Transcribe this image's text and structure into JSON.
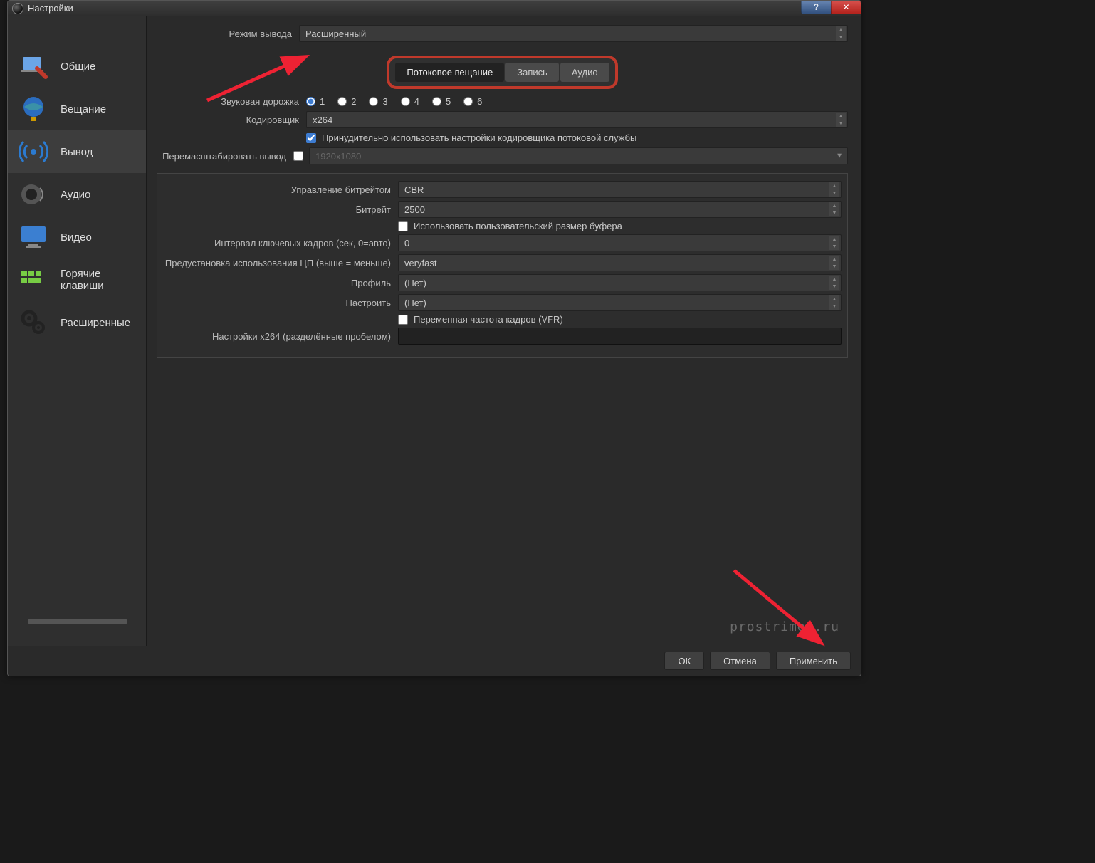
{
  "window": {
    "title": "Настройки"
  },
  "titlebar_buttons": {
    "help": "?",
    "close": "✕"
  },
  "sidebar": {
    "items": [
      {
        "label": "Общие"
      },
      {
        "label": "Вещание"
      },
      {
        "label": "Вывод"
      },
      {
        "label": "Аудио"
      },
      {
        "label": "Видео"
      },
      {
        "label": "Горячие клавиши"
      },
      {
        "label": "Расширенные"
      }
    ]
  },
  "output_mode": {
    "label": "Режим вывода",
    "value": "Расширенный"
  },
  "tabs": {
    "streaming": "Потоковое вещание",
    "recording": "Запись",
    "audio": "Аудио"
  },
  "audio_track": {
    "label": "Звуковая дорожка",
    "options": [
      "1",
      "2",
      "3",
      "4",
      "5",
      "6"
    ]
  },
  "encoder": {
    "label": "Кодировщик",
    "value": "x264"
  },
  "enforce": {
    "label": "Принудительно использовать настройки кодировщика потоковой службы",
    "checked": true
  },
  "rescale": {
    "label": "Перемасштабировать вывод",
    "placeholder": "1920x1080",
    "checked": false
  },
  "rate_control": {
    "label": "Управление битрейтом",
    "value": "CBR"
  },
  "bitrate": {
    "label": "Битрейт",
    "value": "2500"
  },
  "custom_buffer": {
    "label": "Использовать пользовательский размер буфера",
    "checked": false
  },
  "keyframe": {
    "label": "Интервал ключевых кадров (сек, 0=авто)",
    "value": "0"
  },
  "cpu_preset": {
    "label": "Предустановка использования ЦП (выше = меньше)",
    "value": "veryfast"
  },
  "profile": {
    "label": "Профиль",
    "value": "(Нет)"
  },
  "tune": {
    "label": "Настроить",
    "value": "(Нет)"
  },
  "vfr": {
    "label": "Переменная частота кадров (VFR)",
    "checked": false
  },
  "x264opts": {
    "label": "Настройки x264 (разделённые пробелом)",
    "value": ""
  },
  "buttons": {
    "ok": "ОК",
    "cancel": "Отмена",
    "apply": "Применить"
  },
  "watermark": "prostrimer.ru"
}
